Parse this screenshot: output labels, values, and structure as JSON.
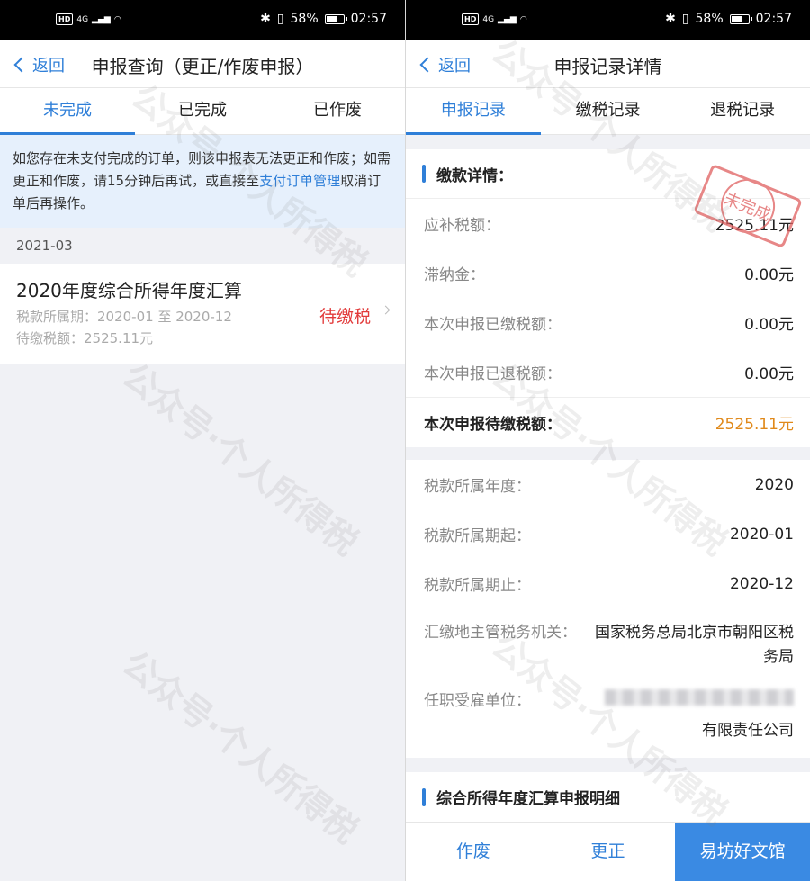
{
  "status": {
    "network": "4G",
    "hd": "HD",
    "battery": "58%",
    "time": "02:57"
  },
  "left": {
    "back_label": "返回",
    "title": "申报查询（更正/作废申报）",
    "tabs": [
      "未完成",
      "已完成",
      "已作废"
    ],
    "notice_prefix": "如您存在未支付完成的订单，则该申报表无法更正和作废；如需更正和作废，请15分钟后再试，或直接至",
    "notice_link": "支付订单管理",
    "notice_suffix": "取消订单后再操作。",
    "month": "2021-03",
    "record": {
      "title": "2020年度综合所得年度汇算",
      "period": "税款所属期：2020-01 至 2020-12",
      "pending": "待缴税额：2525.11元",
      "status": "待缴税"
    }
  },
  "right": {
    "back_label": "返回",
    "title": "申报记录详情",
    "tabs": [
      "申报记录",
      "缴税记录",
      "退税记录"
    ],
    "payment": {
      "heading": "缴款详情：",
      "rows": [
        {
          "k": "应补税额：",
          "v": "2525.11元"
        },
        {
          "k": "滞纳金：",
          "v": "0.00元"
        },
        {
          "k": "本次申报已缴税额：",
          "v": "0.00元"
        },
        {
          "k": "本次申报已退税额：",
          "v": "0.00元"
        }
      ],
      "total_label": "本次申报待缴税额：",
      "total_value": "2525.11元",
      "stamp": "未完成"
    },
    "info": {
      "year_label": "税款所属年度：",
      "year": "2020",
      "start_label": "税款所属期起：",
      "start": "2020-01",
      "end_label": "税款所属期止：",
      "end": "2020-12",
      "authority_label": "汇缴地主管税务机关：",
      "authority": "国家税务总局北京市朝阳区税务局",
      "employer_label": "任职受雇单位：",
      "employer": "有限责任公司"
    },
    "detail_heading": "综合所得年度汇算申报明细",
    "buttons": [
      "作废",
      "更正",
      "易坊好文馆"
    ]
  },
  "watermark": "公众号·个人所得税"
}
